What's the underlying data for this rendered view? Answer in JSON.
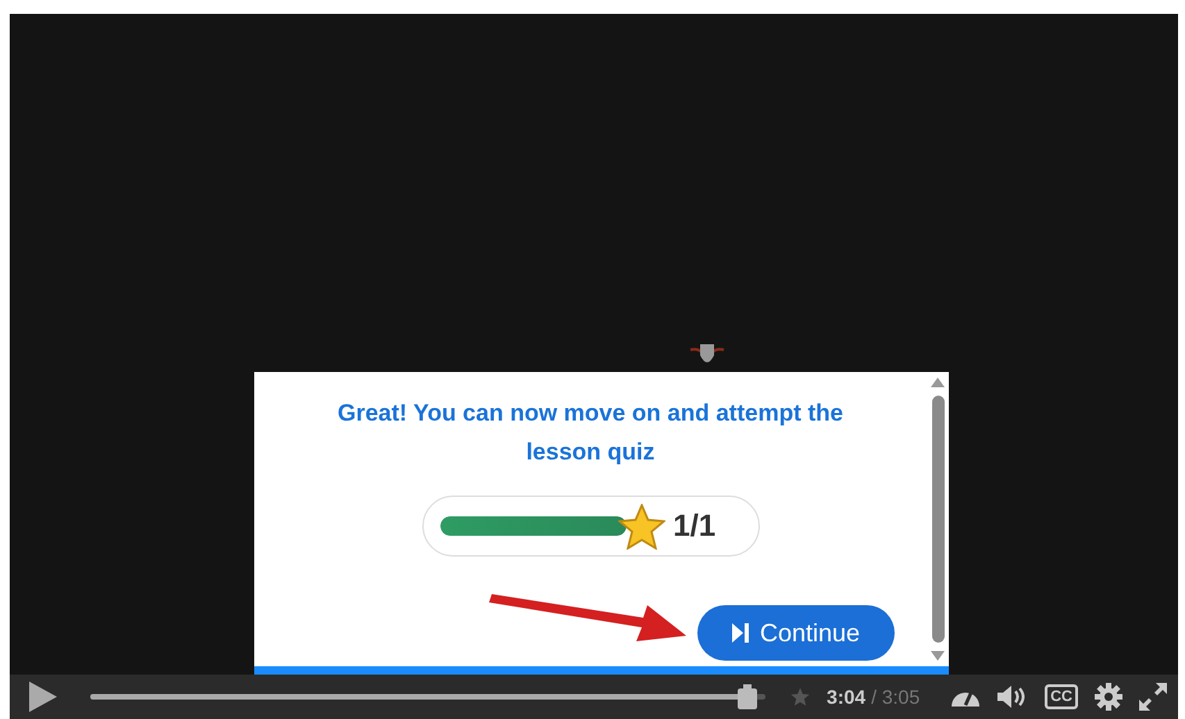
{
  "quiz_panel": {
    "message": "Great! You can now move on and attempt the lesson quiz",
    "progress": {
      "level": 1,
      "score": "1/1"
    },
    "continue_button": {
      "label": "Continue"
    }
  },
  "player": {
    "seek": {
      "level": 0.98
    },
    "current_time": "3:04",
    "duration": "/ 3:05",
    "cc_label": "CC"
  }
}
